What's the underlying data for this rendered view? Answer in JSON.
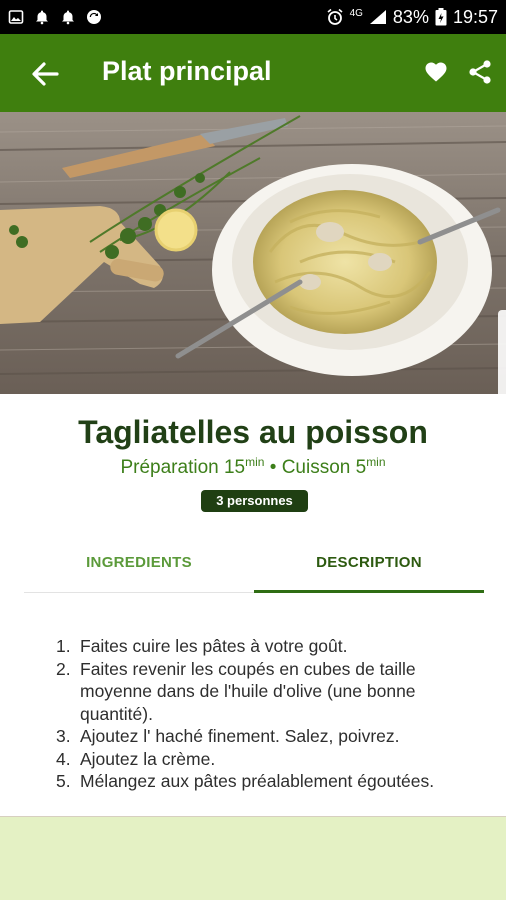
{
  "status_bar": {
    "battery": "83%",
    "time": "19:57",
    "network": "4G"
  },
  "app_bar": {
    "title": "Plat principal"
  },
  "recipe": {
    "title": "Tagliatelles au poisson",
    "prep_label": "Préparation 15",
    "prep_unit": "min",
    "separator": " • ",
    "cook_label": "Cuisson 5",
    "cook_unit": "min",
    "servings": "3 personnes"
  },
  "tabs": [
    {
      "label": "INGREDIENTS",
      "selected": false
    },
    {
      "label": "DESCRIPTION",
      "selected": true
    }
  ],
  "steps": [
    {
      "num": "1.",
      "text": "Faites cuire les pâtes à votre goût."
    },
    {
      "num": "2.",
      "text": "Faites revenir les coupés en cubes de taille moyenne dans de l'huile d'olive (une bonne quantité)."
    },
    {
      "num": "3.",
      "text": "Ajoutez l' haché finement. Salez, poivrez."
    },
    {
      "num": "4.",
      "text": "Ajoutez la crème."
    },
    {
      "num": "5.",
      "text": "Mélangez aux pâtes préalablement égoutées."
    }
  ],
  "colors": {
    "primary": "#3f7f0e",
    "title_text": "#214016",
    "accent_text": "#3d7f1a",
    "badge_bg": "#1f3f12",
    "footer_bg": "#e4f1c4"
  }
}
